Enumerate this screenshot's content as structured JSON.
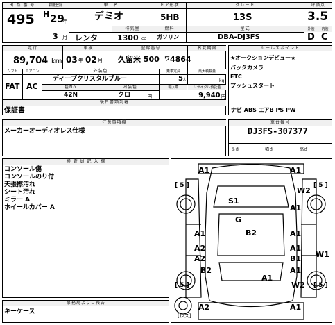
{
  "row1": {
    "h_lot": "出 品 番 号",
    "lot": "495",
    "h_year": "初度登録",
    "era": "H",
    "year": "29",
    "year_unit": "年",
    "month": "3",
    "month_unit": "月",
    "h_name": "車　名",
    "name": "デミオ",
    "h_doors": "ドア形状",
    "doors": "5HB",
    "h_grade": "グレード",
    "grade": "13S",
    "h_score": "評価点",
    "score": "3.5",
    "rental": "レンタ",
    "h_disp": "排気量",
    "disp": "1300",
    "disp_unit": "cc",
    "h_fuel": "燃料",
    "fuel": "ガソリン",
    "h_model": "型式",
    "model": "DBA-DJ3FS",
    "h_ext": "外装",
    "ext": "D",
    "h_int": "内装",
    "int": "C"
  },
  "row2": {
    "h_mileage": "走行",
    "mileage": "89,704",
    "mileage_unit": "km",
    "h_inspect": "車検",
    "inspect_y": "03",
    "inspect_y_unit": "年",
    "inspect_m": "02",
    "inspect_m_unit": "月",
    "h_reg": "登録番号",
    "reg": "久留米 500",
    "reg_kana": "ワ",
    "reg_num": "4864",
    "h_trans": "シフト",
    "trans": "FAT",
    "h_ac": "エアコン",
    "ac": "AC",
    "h_color": "外装色",
    "color": "ディープクリスタルブルー",
    "h_color_no": "色No.",
    "color_no": "42N",
    "h_int_color": "内装色",
    "int_color": "クロ",
    "h_cap": "乗車定員",
    "cap": "5",
    "cap_unit": "人",
    "h_load": "最大積載量",
    "load_unit": "kg",
    "h_import": "輸入車",
    "h_recycle": "リサイクル預託金",
    "recycle": "9,940",
    "recycle_unit": "円",
    "h_name_change": "名変期限",
    "h_warranty": "後日書類到着",
    "warranty": "保証書",
    "h_sales": "セールスポイント",
    "sales": [
      "★オークションデビュー★",
      "バックカメラ",
      "ETC",
      "プッシュスタート"
    ],
    "equip": "ナビ  ABS  エアB  PS  PW",
    "h_notes": "注意事項欄",
    "notes": "メーカーオーディオレス仕様",
    "h_vin": "車台番号",
    "vin": "DJ3FS-307377",
    "len_label": "長さ",
    "width_label": "幅さ",
    "height_label": "高さ"
  },
  "inspector": {
    "header": "検 査 員 記 入 欄",
    "lines": [
      "コンソール傷",
      "コンソールのり付",
      "天張擦汚れ",
      "シート汚れ",
      "ミラー A",
      "ホイールカバー A"
    ]
  },
  "office": {
    "header": "事務局よりご報告",
    "text": "キーケース"
  },
  "diagram": {
    "bracket_5": "5",
    "tag_les": "レス",
    "marks": [
      "A1",
      "A1",
      "W2",
      "A1",
      "S1",
      "G",
      "A1",
      "B2",
      "A1",
      "A2",
      "A1",
      "A2",
      "B1",
      "B2",
      "A1",
      "W1",
      "A1",
      "W2",
      "A2",
      "A1"
    ]
  },
  "colors": {
    "header_bg": "#f0f0f0",
    "line": "#000000"
  }
}
